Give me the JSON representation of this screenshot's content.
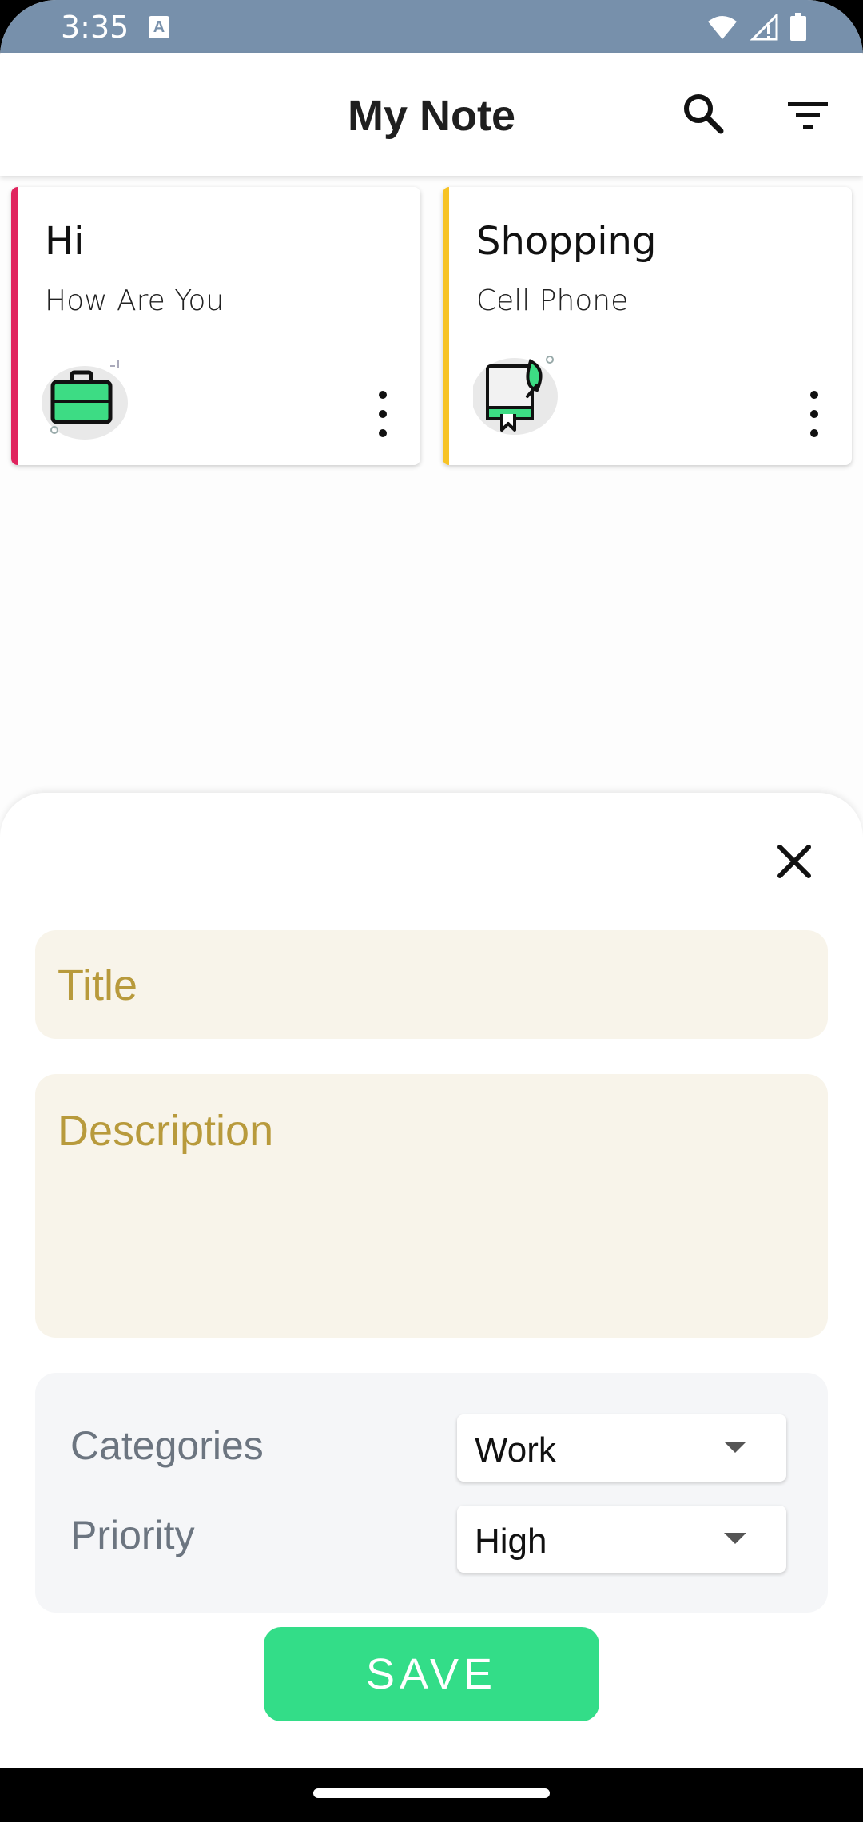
{
  "status_bar": {
    "time": "3:35",
    "keyboard_badge": "A",
    "icons": [
      "wifi-icon",
      "signal-icon",
      "battery-icon"
    ]
  },
  "app_bar": {
    "title": "My Note",
    "actions": [
      "search-icon",
      "filter-icon"
    ]
  },
  "notes": [
    {
      "title": "Hi",
      "description": "How Are You",
      "accent_color": "#e0245e",
      "icon": "briefcase-icon"
    },
    {
      "title": "Shopping",
      "description": "Cell Phone",
      "accent_color": "#f7c325",
      "icon": "leaf-book-icon"
    }
  ],
  "sheet": {
    "title_placeholder": "Title",
    "description_placeholder": "Description",
    "categories_label": "Categories",
    "categories_value": "Work",
    "priority_label": "Priority",
    "priority_value": "High",
    "save_label": "SAVE"
  },
  "colors": {
    "status_bar": "#7790ab",
    "field_bg": "#f8f4ea",
    "placeholder": "#b89a3c",
    "save_button": "#33dd88"
  }
}
